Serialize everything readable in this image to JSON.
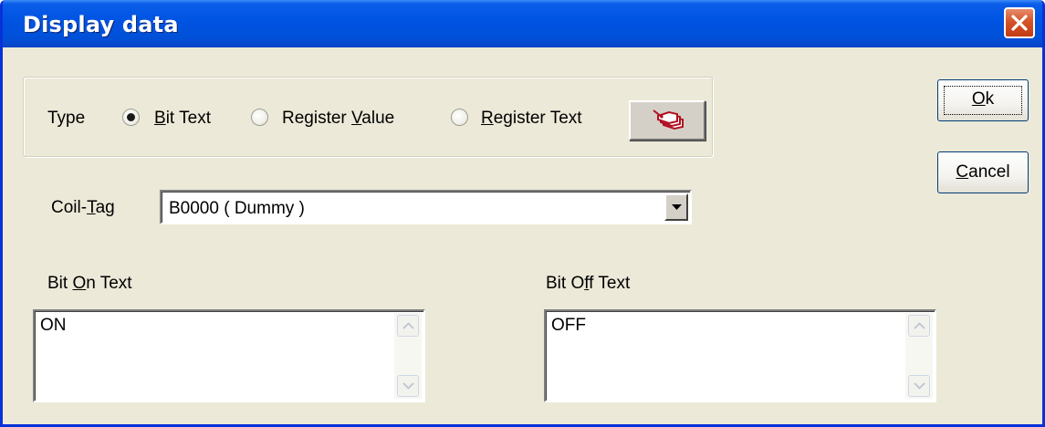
{
  "window": {
    "title": "Display data",
    "close_icon": "close-x-icon"
  },
  "type_group": {
    "label": "Type",
    "options": [
      {
        "label_pre": "",
        "mnemonic": "B",
        "label_post": "it Text",
        "selected": true
      },
      {
        "label_pre": "Register ",
        "mnemonic": "V",
        "label_post": "alue",
        "selected": false
      },
      {
        "label_pre": "",
        "mnemonic": "R",
        "label_post": "egister Text",
        "selected": false
      }
    ],
    "tag_button_icon": "tags-icon"
  },
  "buttons": {
    "ok": {
      "mnemonic": "O",
      "rest": "k"
    },
    "cancel": {
      "mnemonic": "C",
      "rest": "ancel"
    }
  },
  "coil_tag": {
    "label_pre": "Coil-",
    "mnemonic": "T",
    "label_post": "ag",
    "value": "B0000 ( Dummy )"
  },
  "bit_on": {
    "label_pre": "Bit ",
    "mnemonic": "O",
    "label_post": "n Text",
    "value": "ON"
  },
  "bit_off": {
    "label_pre": "Bit O",
    "mnemonic": "f",
    "label_post": "f Text",
    "value": "OFF"
  },
  "colors": {
    "title_bar": "#0054e3",
    "face": "#ece9d8",
    "close": "#d4542a"
  }
}
